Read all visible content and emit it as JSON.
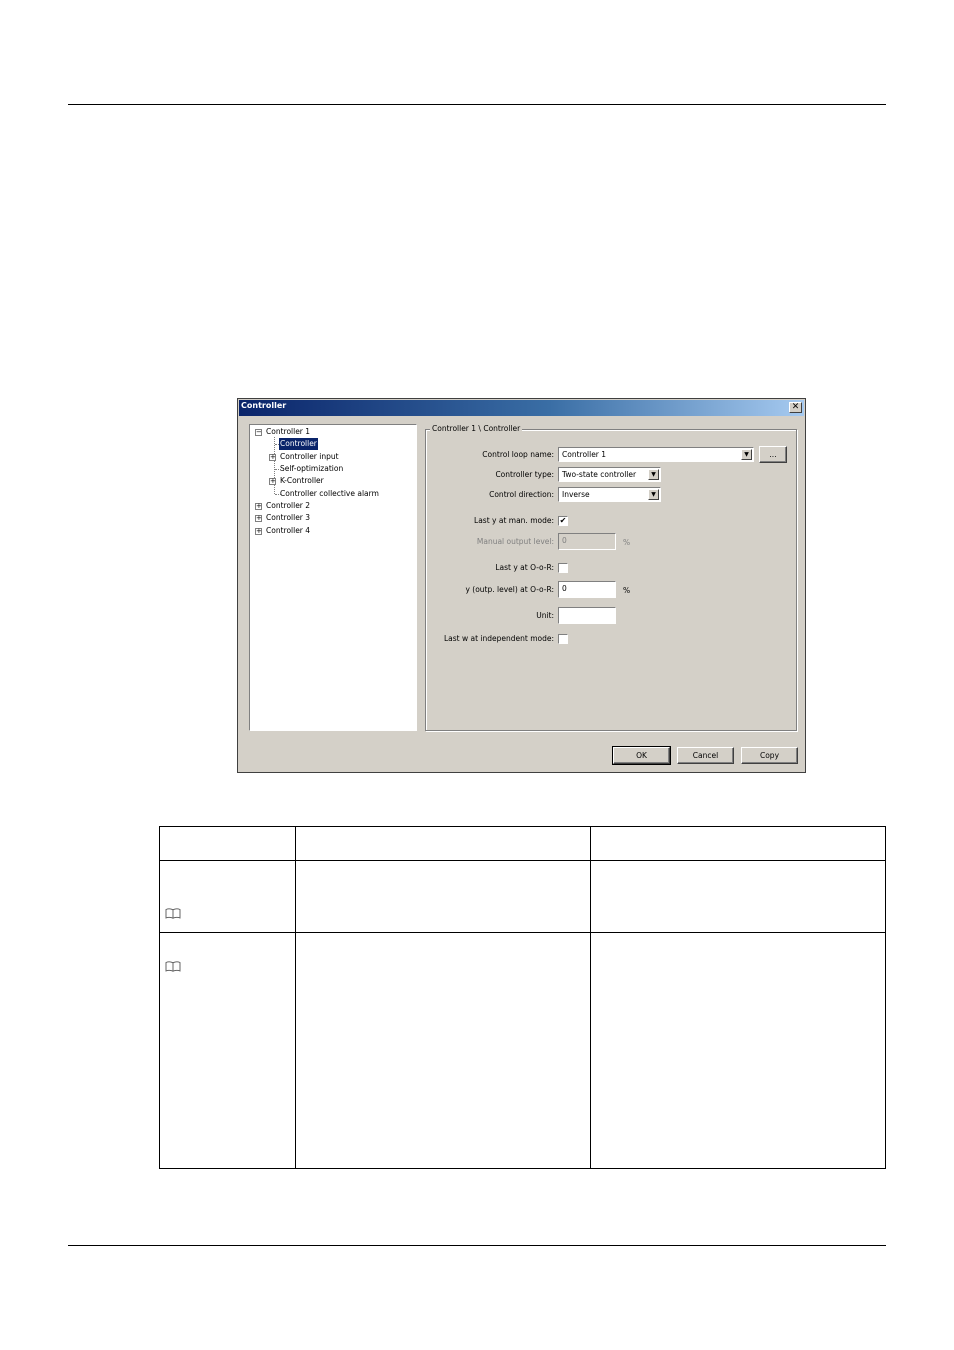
{
  "dialog": {
    "title": "Controller",
    "close_glyph": "✕",
    "tree": {
      "items": [
        {
          "label": "Controller 1",
          "expander": "−"
        },
        {
          "label": "Controller",
          "selected": true
        },
        {
          "label": "Controller input",
          "expander": "+"
        },
        {
          "label": "Self-optimization"
        },
        {
          "label": "K-Controller",
          "expander": "+"
        },
        {
          "label": "Controller collective alarm"
        },
        {
          "label": "Controller 2",
          "expander": "+"
        },
        {
          "label": "Controller 3",
          "expander": "+"
        },
        {
          "label": "Controller 4",
          "expander": "+"
        }
      ]
    },
    "group_title": "Controller 1 \\ Controller",
    "fields": {
      "control_loop_name": {
        "label": "Control loop name:",
        "value": "Controller 1",
        "browse_label": "..."
      },
      "controller_type": {
        "label": "Controller type:",
        "value": "Two-state controller"
      },
      "control_direction": {
        "label": "Control direction:",
        "value": "Inverse"
      },
      "last_y_man_mode": {
        "label": "Last y at man. mode:",
        "checked": true,
        "check_glyph": "✔"
      },
      "manual_output_level": {
        "label": "Manual output level:",
        "value": "0",
        "unit": "%"
      },
      "last_y_oor": {
        "label": "Last y at O-o-R:",
        "checked": false
      },
      "y_outp_level_oor": {
        "label": "y (outp. level) at O-o-R:",
        "value": "0",
        "unit": "%"
      },
      "unit": {
        "label": "Unit:",
        "value": ""
      },
      "last_w_independent": {
        "label": "Last w at independent mode:",
        "checked": false
      }
    },
    "buttons": {
      "ok": "OK",
      "cancel": "Cancel",
      "copy": "Copy"
    },
    "dropdown_glyph": "▼"
  },
  "table": {
    "icons": [
      "book-icon",
      "book-icon"
    ]
  }
}
